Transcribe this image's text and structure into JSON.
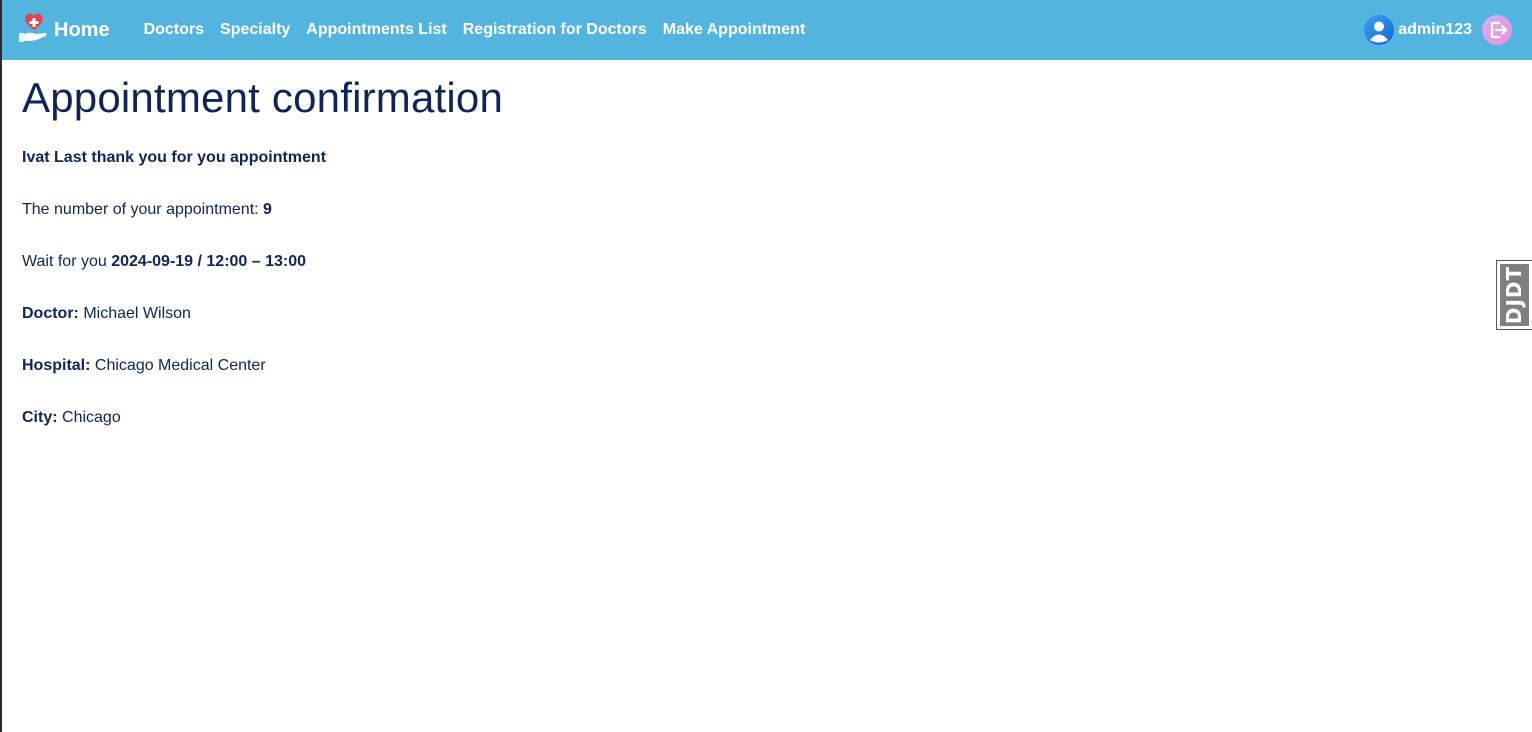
{
  "navbar": {
    "brand_label": "Home",
    "links": [
      "Doctors",
      "Specialty",
      "Appointments List",
      "Registration for Doctors",
      "Make Appointment"
    ],
    "username": "admin123",
    "colors": {
      "bar": "#54b4e0",
      "text": "#ffffff"
    }
  },
  "page": {
    "title": "Appointment confirmation",
    "thanks": "Ivat Last thank you for you appointment",
    "number_label": "The number of your appointment:",
    "number_value": "9",
    "wait_label": "Wait for you",
    "wait_value": "2024-09-19 / 12:00 – 13:00",
    "doctor_label": "Doctor:",
    "doctor_value": "Michael Wilson",
    "hospital_label": "Hospital:",
    "hospital_value": "Chicago Medical Center",
    "city_label": "City:",
    "city_value": "Chicago"
  },
  "toolbar": {
    "handle_label": "DJDT"
  },
  "icons": {
    "brand": "heart-hand-icon",
    "avatar": "user-avatar-icon",
    "logout": "logout-icon"
  },
  "colors": {
    "text": "#0f2557",
    "accent": "#54b4e0"
  }
}
